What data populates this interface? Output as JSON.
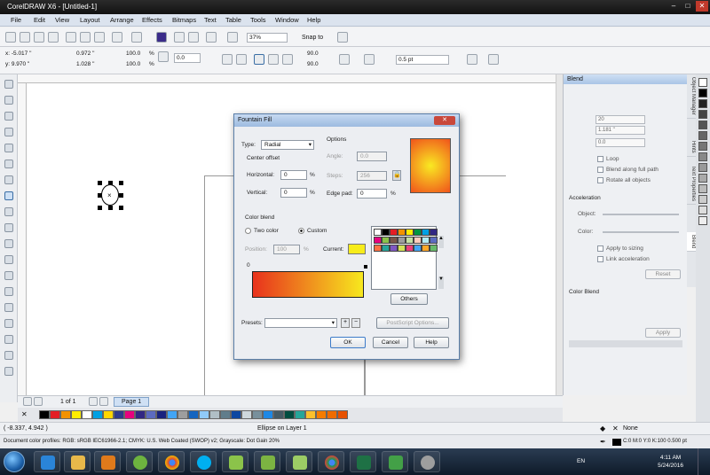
{
  "window": {
    "title": "CorelDRAW X6 - [Untitled-1]",
    "buttons": [
      "–",
      "□",
      "✕"
    ]
  },
  "menu": [
    "File",
    "Edit",
    "View",
    "Layout",
    "Arrange",
    "Effects",
    "Bitmaps",
    "Text",
    "Table",
    "Tools",
    "Window",
    "Help"
  ],
  "toolbar1": {
    "zoom": "37%",
    "snap_to": "Snap to"
  },
  "propbar": {
    "x": "x: -5.017 \"",
    "y": "y: 9.970 \"",
    "w": "0.972 \"",
    "h": "1.028 \"",
    "scale_x": "100.0",
    "scale_y": "100.0",
    "pct": "%",
    "angle": "0.0",
    "start_angle": "90.0",
    "end_angle": "90.0",
    "outline": "0.5 pt"
  },
  "canvas": {
    "page_nav": "1 of 1",
    "page_tab": "Page 1"
  },
  "dialog": {
    "title": "Fountain Fill",
    "close": "✕",
    "type_label": "Type:",
    "type_value": "Radial",
    "center_offset": "Center offset",
    "horizontal_label": "Horizontal:",
    "horizontal_value": "0",
    "vertical_label": "Vertical:",
    "vertical_value": "0",
    "pct": "%",
    "options_label": "Options",
    "angle_label": "Angle:",
    "angle_value": "0.0",
    "steps_label": "Steps:",
    "steps_value": "256",
    "edge_pad_label": "Edge pad:",
    "edge_pad_value": "0",
    "color_blend": "Color blend",
    "two_color": "Two color",
    "custom": "Custom",
    "position_label": "Position:",
    "position_value": "100",
    "current_label": "Current:",
    "zero_marker": "0",
    "others": "Others",
    "presets_label": "Presets:",
    "postscript": "PostScript Options...",
    "ok": "OK",
    "cancel": "Cancel",
    "help": "Help",
    "colors": {
      "gradient_start": "#e8321d",
      "gradient_end": "#f7e81e",
      "radial_center": "#f9ea22",
      "radial_edge": "#f0531b",
      "current": "#f7ec1a"
    }
  },
  "docker": {
    "title": "Blend",
    "steps": "20",
    "spacing": "1.181 \"",
    "rotation": "0.0",
    "loop": "Loop",
    "blend_full_path": "Blend along full path",
    "rotate_all": "Rotate all objects",
    "acceleration": "Acceleration",
    "object_label": "Object:",
    "color_label": "Color:",
    "apply_sizing": "Apply to sizing",
    "link_accel": "Link acceleration",
    "reset": "Reset",
    "color_blend": "Color Blend",
    "apply": "Apply",
    "tabs": [
      "Object Manager",
      "Hints",
      "Text Properties",
      "Blend"
    ]
  },
  "status": {
    "coords": "( -8.337, 4.942 )",
    "object_info": "Ellipse on Layer 1",
    "profiles": "Document color profiles: RGB: sRGB IEC61966-2.1; CMYK: U.S. Web Coated (SWOP) v2; Grayscale: Dot Gain 20%",
    "fill_none": "None",
    "outline_info": "C:0 M:0 Y:0 K:100  0.500 pt"
  },
  "taskbar": {
    "lang": "EN",
    "time": "4:11 AM",
    "date": "5/24/2016"
  },
  "palette_colors": [
    "#ffffff",
    "#000000",
    "#e31e24",
    "#f39200",
    "#ffed00",
    "#009640",
    "#00a0e3",
    "#312783",
    "#e6007e",
    "#8bc34a",
    "#795548",
    "#9e9e9e",
    "#c5e1a5",
    "#ffccbc",
    "#b2ebf2",
    "#5c6bc0",
    "#ff7043",
    "#26a69a",
    "#7e57c2",
    "#d4e157",
    "#ec407a",
    "#42a5f5",
    "#ffa726",
    "#66bb6a"
  ]
}
